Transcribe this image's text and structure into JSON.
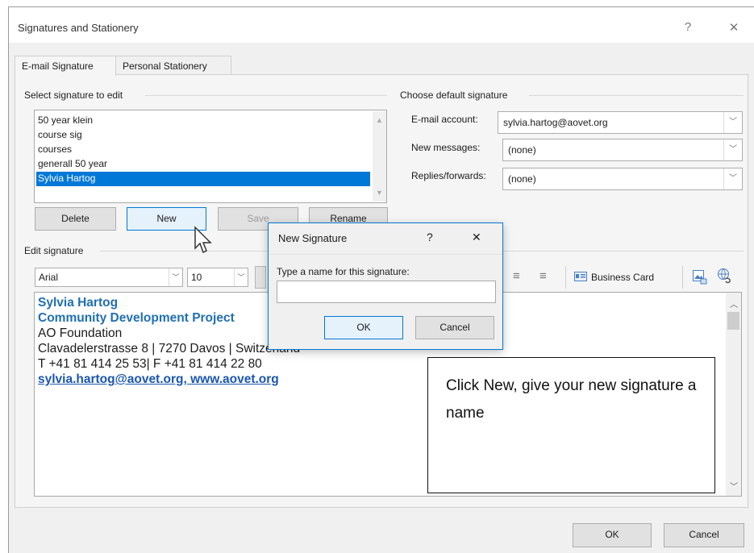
{
  "window": {
    "title": "Signatures and Stationery",
    "help_glyph": "?",
    "close_glyph": "✕"
  },
  "tabs": [
    {
      "label": "E-mail Signature",
      "active": true
    },
    {
      "label": "Personal Stationery",
      "active": false
    }
  ],
  "select_signature": {
    "group_label": "Select signature to edit",
    "items": [
      "50 year klein",
      "course sig",
      "courses",
      "generall 50 year",
      "Sylvia Hartog"
    ],
    "selected": "Sylvia Hartog"
  },
  "buttons": {
    "delete": "Delete",
    "new": "New",
    "save": "Save",
    "rename": "Rename"
  },
  "default_signature": {
    "group_label": "Choose default signature",
    "email_account_label": "E-mail account:",
    "email_account_value": "sylvia.hartog@aovet.org",
    "new_messages_label": "New messages:",
    "new_messages_value": "(none)",
    "replies_label": "Replies/forwards:",
    "replies_value": "(none)"
  },
  "edit_signature": {
    "group_label": "Edit signature",
    "font": "Arial",
    "size": "10",
    "business_card": "Business Card",
    "lines": [
      "Sylvia Hartog",
      "Community Development Project",
      "AO Foundation",
      "Clavadelerstrasse 8 | 7270 Davos | Switzerland",
      "T +41 81 414 25 53| F +41 81 414 22 80",
      "sylvia.hartog@aovet.org, www.aovet.org"
    ]
  },
  "new_signature_dialog": {
    "title": "New Signature",
    "help_glyph": "?",
    "close_glyph": "✕",
    "prompt": "Type a name for this signature:",
    "input_value": "",
    "ok": "OK",
    "cancel": "Cancel"
  },
  "footer": {
    "ok": "OK",
    "cancel": "Cancel"
  },
  "annotation": {
    "text": "Click New, give your new signature a name"
  },
  "colors": {
    "accent": "#0078d7",
    "signature_blue": "#1f6fb2"
  }
}
